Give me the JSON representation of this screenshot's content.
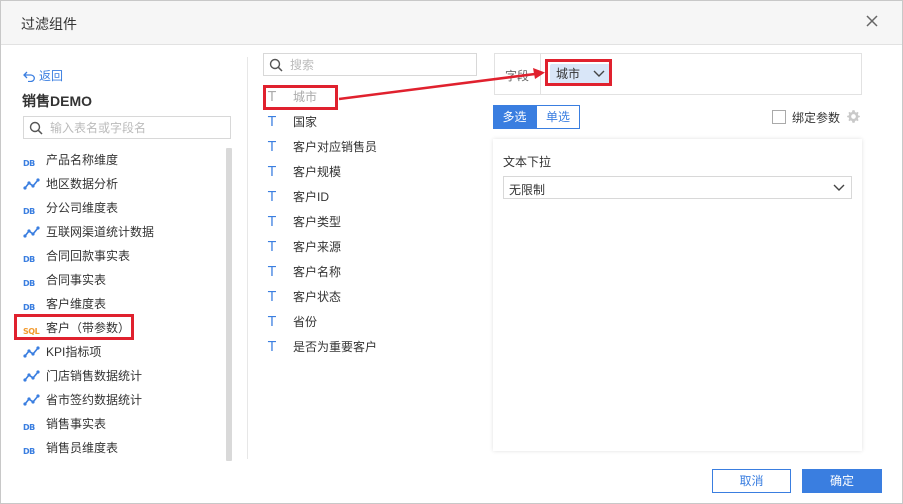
{
  "dialog": {
    "title": "过滤组件",
    "close_icon": "close-icon"
  },
  "left_panel": {
    "back_label": "返回",
    "package_name": "销售DEMO",
    "search_placeholder": "输入表名或字段名",
    "tables": [
      {
        "icon": "DB",
        "label": "产品名称维度"
      },
      {
        "icon": "chart",
        "label": "地区数据分析"
      },
      {
        "icon": "DB",
        "label": "分公司维度表"
      },
      {
        "icon": "chart",
        "label": "互联网渠道统计数据"
      },
      {
        "icon": "DB",
        "label": "合同回款事实表"
      },
      {
        "icon": "DB",
        "label": "合同事实表"
      },
      {
        "icon": "DB",
        "label": "客户维度表"
      },
      {
        "icon": "SQL",
        "label": "客户（带参数）"
      },
      {
        "icon": "chart",
        "label": "KPI指标项"
      },
      {
        "icon": "chart",
        "label": "门店销售数据统计"
      },
      {
        "icon": "chart",
        "label": "省市签约数据统计"
      },
      {
        "icon": "DB",
        "label": "销售事实表"
      },
      {
        "icon": "DB",
        "label": "销售员维度表"
      }
    ]
  },
  "middle_panel": {
    "search_placeholder": "搜索",
    "fields": [
      {
        "type": "T",
        "label": "城市"
      },
      {
        "type": "T",
        "label": "国家"
      },
      {
        "type": "T",
        "label": "客户对应销售员"
      },
      {
        "type": "T",
        "label": "客户规模"
      },
      {
        "type": "T",
        "label": "客户ID"
      },
      {
        "type": "T",
        "label": "客户类型"
      },
      {
        "type": "T",
        "label": "客户来源"
      },
      {
        "type": "T",
        "label": "客户名称"
      },
      {
        "type": "T",
        "label": "客户状态"
      },
      {
        "type": "T",
        "label": "省份"
      },
      {
        "type": "T",
        "label": "是否为重要客户"
      }
    ]
  },
  "right_panel": {
    "field_label": "字段",
    "field_value": "城市",
    "mode_multi": "多选",
    "mode_single": "单选",
    "bind_param_label": "绑定参数",
    "control_type": "文本下拉",
    "limit_value": "无限制"
  },
  "footer": {
    "cancel_label": "取消",
    "ok_label": "确定"
  },
  "colors": {
    "accent": "#3a7ee0",
    "highlight": "#e0212e",
    "sql_icon": "#f29a2e"
  }
}
